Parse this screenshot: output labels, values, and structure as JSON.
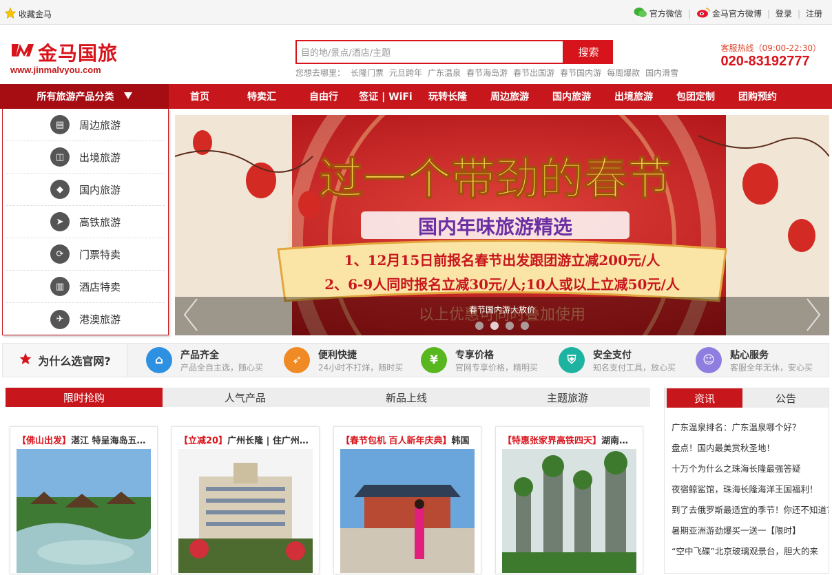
{
  "topbar": {
    "favorite": "收藏金马",
    "wechat": "官方微信",
    "weibo": "金马官方微博",
    "login": "登录",
    "register": "注册"
  },
  "header": {
    "brand": "金马国旅",
    "url": "www.jinmalvyou.com",
    "search_placeholder": "目的地/景点/酒店/主题",
    "search_button": "搜索",
    "hot_label": "您想去哪里：",
    "hot_items": [
      "长隆门票",
      "元旦跨年",
      "广东温泉",
      "春节海岛游",
      "春节出国游",
      "春节国内游",
      "每周爆款",
      "国内滑雪"
    ],
    "hotline_label": "客服热线（09:00-22:30）",
    "hotline_number": "020-83192777"
  },
  "nav": {
    "all_categories": "所有旅游产品分类",
    "links": [
      "首页",
      "特卖汇",
      "自由行",
      "签证 | WiFi",
      "玩转长隆",
      "周边旅游",
      "国内旅游",
      "出境旅游",
      "包团定制",
      "团购预约"
    ]
  },
  "sidebar": {
    "items": [
      {
        "label": "周边旅游",
        "icon": "bus-icon"
      },
      {
        "label": "出境旅游",
        "icon": "suitcase-icon"
      },
      {
        "label": "国内旅游",
        "icon": "china-map-icon"
      },
      {
        "label": "高铁旅游",
        "icon": "train-icon"
      },
      {
        "label": "门票特卖",
        "icon": "ticket-icon"
      },
      {
        "label": "酒店特卖",
        "icon": "hotel-icon"
      },
      {
        "label": "港澳旅游",
        "icon": "plane-icon"
      }
    ]
  },
  "banner": {
    "headline": "过一个带劲的春节",
    "subheadline": "国内年味旅游精选",
    "line1": "1、12月15日前报名春节出发跟团游立减200元/人",
    "line2": "2、6-9人同时报名立减30元/人;10人或以上立减50元/人",
    "footnote": "以上优惠可同时叠加使用",
    "caption": "春节国内游大放价",
    "slide_count": 4,
    "active_slide": 2
  },
  "why": {
    "title": "为什么选官网?",
    "features": [
      {
        "title": "产品齐全",
        "sub": "产品全自主选，随心买",
        "color": "#2e90e0",
        "icon": "home-icon"
      },
      {
        "title": "便利快捷",
        "sub": "24小时不打烊，随时买",
        "color": "#f08a24",
        "icon": "rocket-icon"
      },
      {
        "title": "专享价格",
        "sub": "官网专享价格，精明买",
        "color": "#58b71f",
        "icon": "yen-icon"
      },
      {
        "title": "安全支付",
        "sub": "知名支付工具，放心买",
        "color": "#1db3a0",
        "icon": "shield-icon"
      },
      {
        "title": "贴心服务",
        "sub": "客服全年无休，安心买",
        "color": "#8f7ee0",
        "icon": "service-icon"
      }
    ]
  },
  "product_tabs": [
    "限时抢购",
    "人气产品",
    "新品上线",
    "主题旅游"
  ],
  "products": [
    {
      "tag": "【佛山出发】",
      "title": "湛江 特呈海岛五日游"
    },
    {
      "tag": "【立减20】",
      "title": "广州长隆 | 住广州长隆酒店"
    },
    {
      "tag": "【春节包机 百人新年庆典】",
      "title": "韩国"
    },
    {
      "tag": "【特惠张家界高铁四天】",
      "title": "湖南张家界"
    }
  ],
  "news": {
    "tabs": [
      "资讯",
      "公告"
    ],
    "items": [
      "广东温泉排名：广东温泉哪个好？",
      "盘点！国内最美赏秋圣地！",
      "十万个为什么之珠海长隆最强答疑",
      "夜宿鲸鲨馆，珠海长隆海洋王国福利！",
      "到了去俄罗斯最适宜的季节！你还不知道？",
      "暑期亚洲游劲爆买一送一【限时】",
      "“空中飞碟”北京玻璃观景台，胆大的来"
    ]
  },
  "colors": {
    "brand": "#c8161d",
    "accent": "#d7141b"
  }
}
